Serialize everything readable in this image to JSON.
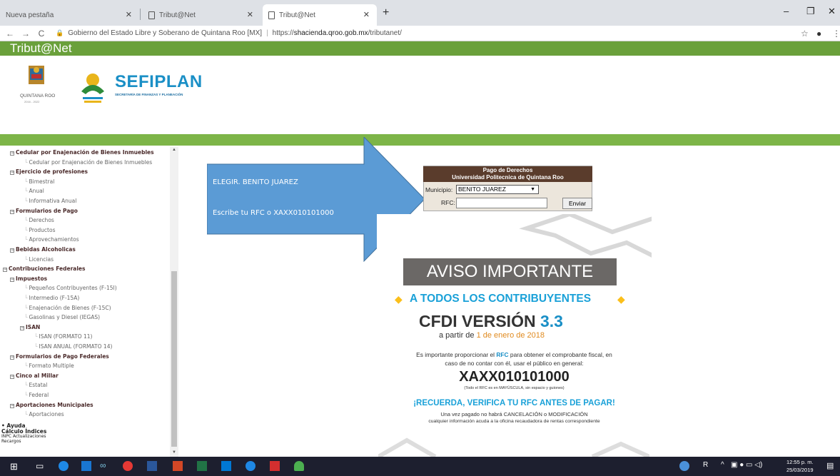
{
  "browser": {
    "tabs": [
      {
        "label": "Nueva pestaña"
      },
      {
        "label": "Tribut@Net"
      },
      {
        "label": "Tribut@Net"
      }
    ],
    "site_name": "Gobierno del Estado Libre y Soberano de Quintana Roo [MX]",
    "url_prefix": "https://",
    "url_domain": "shacienda.qroo.gob.mx",
    "url_path": "/tributanet/"
  },
  "site": {
    "title": "Tribut@Net",
    "qroo_label": "QUINTANA ROO",
    "qroo_years": "2016 - 2022",
    "sefiplan": "SEFIPLAN",
    "sefiplan_sub": "SECRETARÍA DE FINANZAS Y PLANEACIÓN"
  },
  "sidebar": {
    "items": [
      {
        "label": "Cedular por Enajenación de Bienes Inmuebles",
        "level": "group"
      },
      {
        "label": "Cedular por Enajenación de Bienes Inmuebles",
        "level": "child"
      },
      {
        "label": "Ejercicio de profesiones",
        "level": "group"
      },
      {
        "label": "Bimestral",
        "level": "child"
      },
      {
        "label": "Anual",
        "level": "child"
      },
      {
        "label": "Informativa Anual",
        "level": "child"
      },
      {
        "label": "Formularios de Pago",
        "level": "group"
      },
      {
        "label": "Derechos",
        "level": "child"
      },
      {
        "label": "Productos",
        "level": "child"
      },
      {
        "label": "Aprovechamientos",
        "level": "child"
      },
      {
        "label": "Bebidas Alcoholicas",
        "level": "group"
      },
      {
        "label": "Licencias",
        "level": "child"
      },
      {
        "label": "Contribuciones Federales",
        "level": "root"
      },
      {
        "label": "Impuestos",
        "level": "group"
      },
      {
        "label": "Pequeños Contribuyentes (F-15I)",
        "level": "child"
      },
      {
        "label": "Intermedio (F-15A)",
        "level": "child"
      },
      {
        "label": "Enajenación de Bienes (F-15C)",
        "level": "child"
      },
      {
        "label": "Gasolinas y Diesel (IEGAS)",
        "level": "child"
      },
      {
        "label": "ISAN",
        "level": "subgroup"
      },
      {
        "label": "ISAN (FORMATO 11)",
        "level": "subchild"
      },
      {
        "label": "ISAN ANUAL (FORMATO 14)",
        "level": "subchild"
      },
      {
        "label": "Formularios de Pago Federales",
        "level": "group"
      },
      {
        "label": "Formato Multiple",
        "level": "child"
      },
      {
        "label": "Cinco al Millar",
        "level": "group"
      },
      {
        "label": "Estatal",
        "level": "child"
      },
      {
        "label": "Federal",
        "level": "child"
      },
      {
        "label": "Aportaciones Municipales",
        "level": "group"
      },
      {
        "label": "Aportaciones",
        "level": "child"
      }
    ],
    "footer": [
      "• Ayuda",
      "Cálculo Índices",
      "INPC Actualizaciones",
      "Recargos"
    ]
  },
  "annotation": {
    "line1": "ELEGIR. BENITO JUAREZ",
    "line2": "Escribe tu RFC o XAXX010101000"
  },
  "form": {
    "title1": "Pago de Derechos",
    "title2": "Universidad Politecnica de Quintana Roo",
    "municipio_label": "Municipio:",
    "municipio_value": "BENITO JUAREZ",
    "rfc_label": "RFC:",
    "rfc_value": "",
    "submit": "Enviar"
  },
  "notice": {
    "aviso": "AVISO IMPORTANTE",
    "todos": "A TODOS LOS CONTRIBUYENTES",
    "cfdi": "CFDI VERSIÓN",
    "cfdi_ver": "3.3",
    "fecha_pre": "a partir de",
    "fecha": "1 de enero de 2018",
    "texto1_pre": "Es importante proporcionar el",
    "texto1_rfc": "RFC",
    "texto1_post": "para obtener el comprobante fiscal, en",
    "texto2": "caso de no contar con él, usar el público en general:",
    "rfc_generico": "XAXX010101000",
    "nota": "(Todo el RFC es en MAYÚSCULA, sin espacio y guiones)",
    "recuerda": "¡RECUERDA, VERIFICA TU RFC ANTES DE PAGAR!",
    "texto3": "Una vez pagado no habrá CANCELACIÓN o MODIFICACIÓN",
    "texto4": "cualquier información acuda a la oficina recaudadora de rentas correspondiente"
  },
  "taskbar": {
    "time": "12:55 p. m.",
    "date": "25/03/2019"
  }
}
